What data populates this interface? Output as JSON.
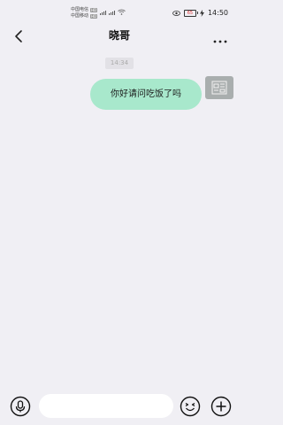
{
  "status_bar": {
    "carrier_1": "中国电信",
    "carrier_2": "中国移动",
    "hd_label": "HD",
    "battery_level": "65",
    "time": "14:50",
    "icons": [
      "signal-icon",
      "wifi-icon",
      "eye-icon",
      "battery-icon",
      "charging-icon"
    ]
  },
  "header": {
    "title": "晓哥",
    "back_icon": "chevron-left-icon",
    "more_icon": "more-horizontal-icon"
  },
  "messages": [
    {
      "time": "14:34",
      "text": "你好请问吃饭了吗",
      "direction": "outgoing",
      "bubble_color": "#a8e8cc"
    }
  ],
  "input_bar": {
    "value": "",
    "placeholder": "",
    "icons": [
      "microphone-icon",
      "emoji-icon",
      "plus-icon"
    ]
  },
  "colors": {
    "background": "#f0eff4",
    "bubble": "#a8e8cc",
    "avatar": "#a9aeae"
  }
}
